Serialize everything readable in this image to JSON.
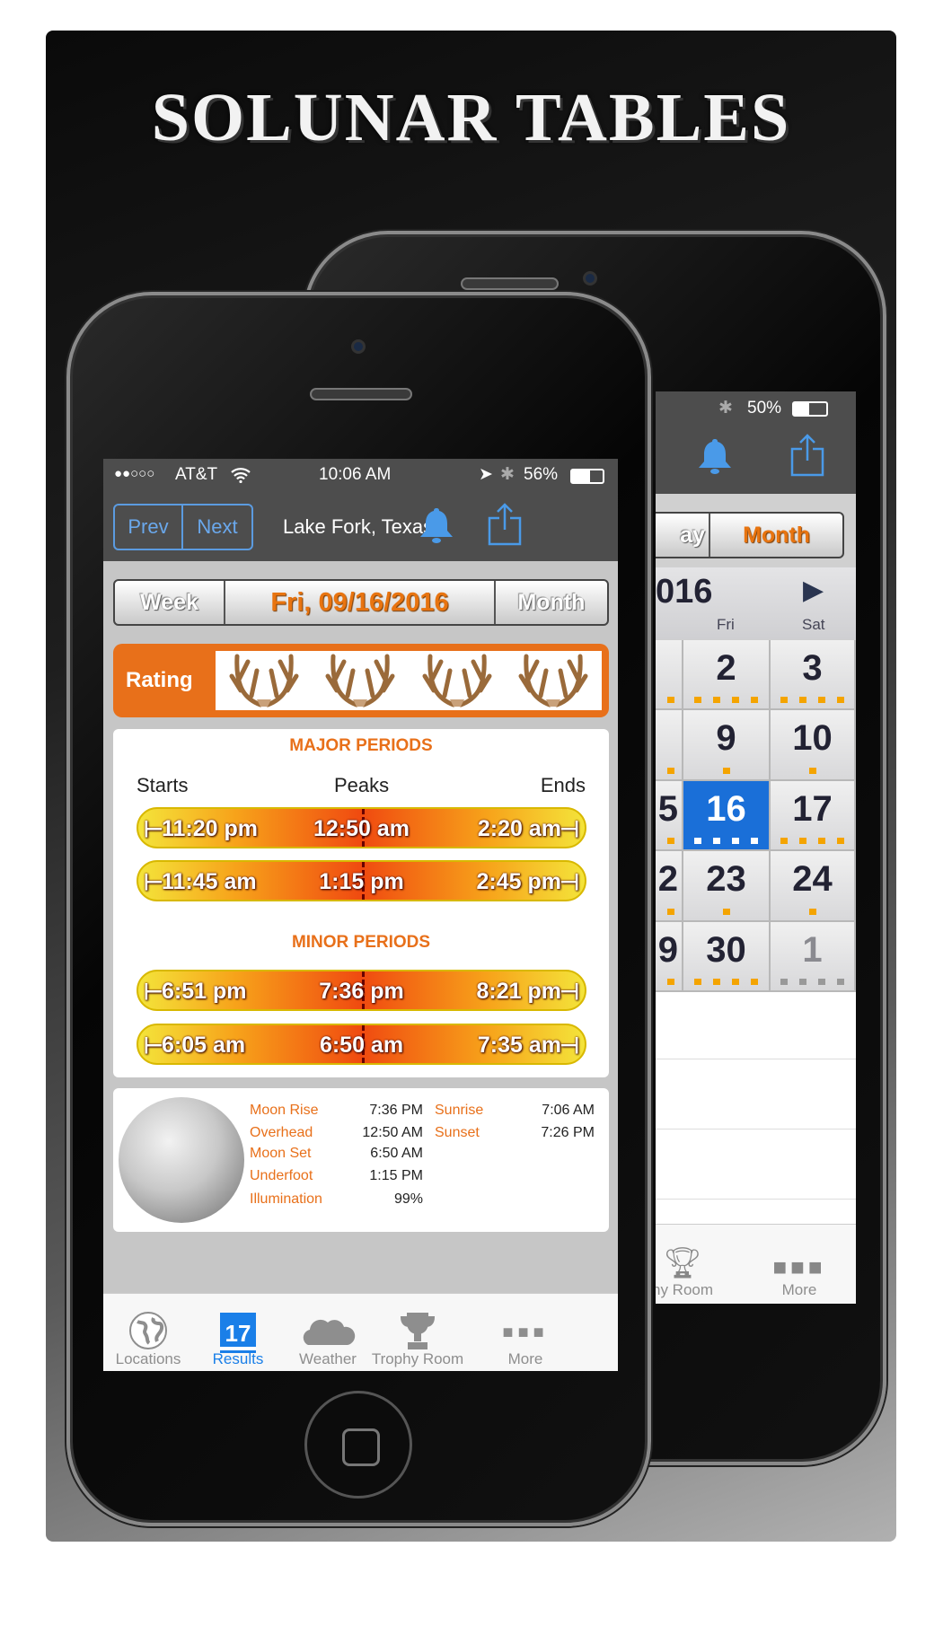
{
  "title": "SOLUNAR TABLES",
  "colors": {
    "accent_orange": "#e8701a",
    "ios_blue": "#4a9ae8",
    "selected_day": "#1a6fd8",
    "dot": "#f4a400"
  },
  "front_phone": {
    "status_bar": {
      "signal": "●●○○○",
      "carrier": "AT&T",
      "wifi_icon": "wifi-icon",
      "time": "10:06 AM",
      "location_icon": "location-arrow-icon",
      "bluetooth_icon": "bluetooth-icon",
      "battery": "56%"
    },
    "nav": {
      "prev": "Prev",
      "next": "Next",
      "location": "Lake Fork, Texas",
      "bell_icon": "bell-icon",
      "share_icon": "share-icon"
    },
    "segment": {
      "week": "Week",
      "date": "Fri, 09/16/2016",
      "month": "Month",
      "selected": "date"
    },
    "rating": {
      "label": "Rating",
      "value": 4,
      "max": 4,
      "icon": "antler-icon"
    },
    "major": {
      "title": "MAJOR PERIODS",
      "col_starts": "Starts",
      "col_peaks": "Peaks",
      "col_ends": "Ends",
      "periods": [
        {
          "start": "11:20 pm",
          "peak": "12:50 am",
          "end": "2:20 am"
        },
        {
          "start": "11:45 am",
          "peak": "1:15 pm",
          "end": "2:45 pm"
        }
      ]
    },
    "minor": {
      "title": "MINOR PERIODS",
      "periods": [
        {
          "start": "6:51 pm",
          "peak": "7:36 pm",
          "end": "8:21 pm"
        },
        {
          "start": "6:05 am",
          "peak": "6:50 am",
          "end": "7:35 am"
        }
      ]
    },
    "moon": {
      "illumination_pct": 99,
      "rows": [
        {
          "label": "Moon Rise",
          "value": "7:36 PM"
        },
        {
          "label": "Overhead",
          "value": "12:50 AM"
        },
        {
          "label": "Moon Set",
          "value": "6:50 AM"
        },
        {
          "label": "Underfoot",
          "value": "1:15 PM"
        },
        {
          "label": "Illumination",
          "value": "99%"
        }
      ],
      "sun": [
        {
          "label": "Sunrise",
          "value": "7:06 AM"
        },
        {
          "label": "Sunset",
          "value": "7:26 PM"
        }
      ]
    },
    "tabs": [
      {
        "label": "Locations",
        "icon": "globe-icon"
      },
      {
        "label": "Results",
        "icon": "calendar-icon",
        "badge": "17",
        "active": true
      },
      {
        "label": "Weather",
        "icon": "cloud-icon"
      },
      {
        "label": "Trophy Room",
        "icon": "trophy-icon"
      },
      {
        "label": "More",
        "icon": "more-icon"
      }
    ]
  },
  "back_phone": {
    "status_bar": {
      "bluetooth_icon": "bluetooth-icon",
      "battery": "50%"
    },
    "segment": {
      "day_partial": "ay",
      "month": "Month",
      "selected": "month"
    },
    "calendar": {
      "year_partial": "016",
      "next_icon": "next-month-icon",
      "weekdays": [
        "Fri",
        "Sat"
      ],
      "thu_partial": [
        "",
        "",
        "5",
        "2",
        "9"
      ],
      "rows": [
        [
          {
            "day": "2",
            "dots": 4
          },
          {
            "day": "3",
            "dots": 4
          }
        ],
        [
          {
            "day": "9",
            "dots": 1
          },
          {
            "day": "10",
            "dots": 1
          }
        ],
        [
          {
            "day": "16",
            "dots": 4,
            "selected": true
          },
          {
            "day": "17",
            "dots": 4
          }
        ],
        [
          {
            "day": "23",
            "dots": 1
          },
          {
            "day": "24",
            "dots": 1
          }
        ],
        [
          {
            "day": "30",
            "dots": 4
          },
          {
            "day": "1",
            "dots": 4,
            "other_month": true
          }
        ]
      ]
    },
    "tabs": [
      {
        "label": "hy Room",
        "icon": "trophy-icon"
      },
      {
        "label": "More",
        "icon": "more-icon"
      }
    ]
  }
}
